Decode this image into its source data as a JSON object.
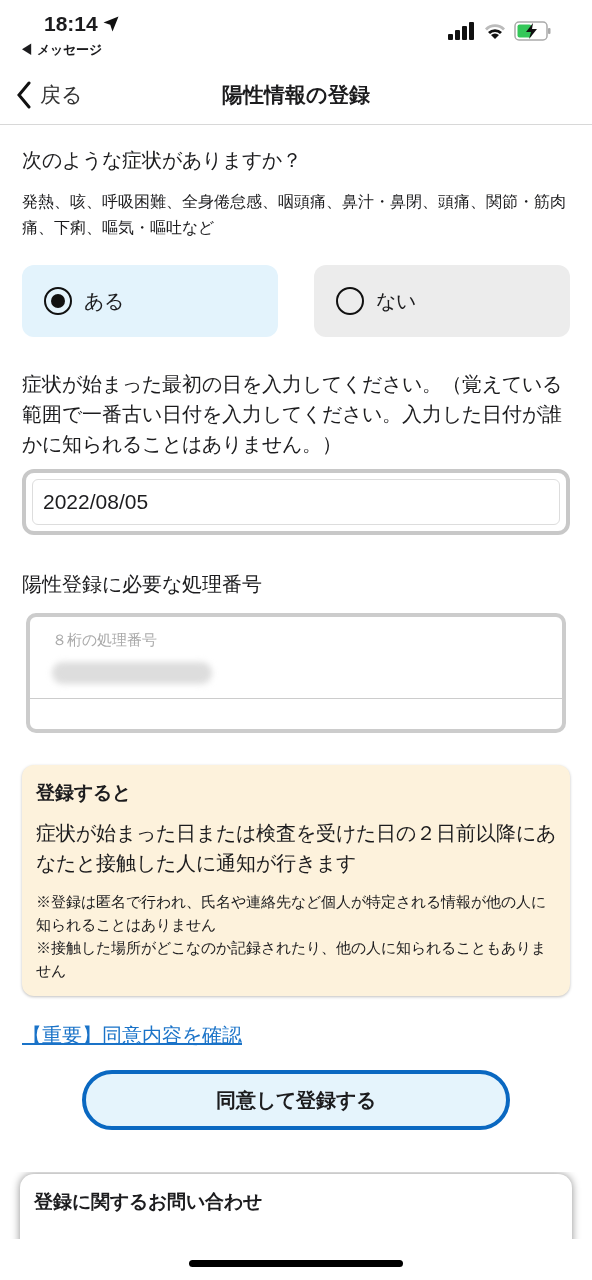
{
  "status_bar": {
    "time": "18:14",
    "back_app": "◀ メッセージ"
  },
  "nav": {
    "back": "戻る",
    "title": "陽性情報の登録"
  },
  "symptoms": {
    "question": "次のような症状がありますか？",
    "examples": "発熱、咳、呼吸困難、全身倦怠感、咽頭痛、鼻汁・鼻閉、頭痛、関節・筋肉痛、下痢、嘔気・嘔吐など",
    "options": [
      {
        "label": "ある",
        "selected": true
      },
      {
        "label": "ない",
        "selected": false
      }
    ]
  },
  "onset": {
    "prompt": "症状が始まった最初の日を入力してください。（覚えている範囲で一番古い日付を入力してください。入力した日付が誰かに知られることはありません。）",
    "value": "2022/08/05"
  },
  "processing_number": {
    "label": "陽性登録に必要な処理番号",
    "placeholder": "８桁の処理番号"
  },
  "notice": {
    "title": "登録すると",
    "body": "症状が始まった日または検査を受けた日の２日前以降にあなたと接触した人に通知が行きます",
    "notes": [
      "※登録は匿名で行われ、氏名や連絡先など個人が特定される情報が他の人に知られることはありません",
      "※接触した場所がどこなのか記録されたり、他の人に知られることもありません"
    ]
  },
  "consent_link": "【重要】同意内容を確認",
  "submit_button": "同意して登録する",
  "contact": {
    "title": "登録に関するお問い合わせ"
  }
}
